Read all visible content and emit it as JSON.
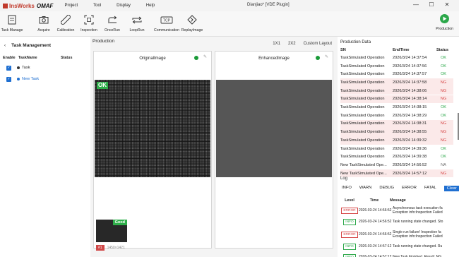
{
  "app": {
    "brand": "InsWorks",
    "product": "OMAF",
    "window_title": "Dianjiao* [VDE Plugin]"
  },
  "menu": [
    "Project",
    "Tool",
    "Display",
    "Help"
  ],
  "toolbar": [
    {
      "label": "Task Manage",
      "icon": "task-manage-icon"
    },
    {
      "label": "Acquire",
      "icon": "camera-icon"
    },
    {
      "label": "Calibration",
      "icon": "ruler-icon"
    },
    {
      "label": "Inspection",
      "icon": "inspection-icon"
    },
    {
      "label": "OnceRun",
      "icon": "once-run-icon"
    },
    {
      "label": "LoopRun",
      "icon": "loop-run-icon"
    },
    {
      "label": "Communication",
      "icon": "tcp-icon"
    },
    {
      "label": "ReplayImage",
      "icon": "replay-icon"
    }
  ],
  "production_button": "Production",
  "task_panel": {
    "title": "Task Management",
    "columns": [
      "Enable",
      "TaskName",
      "Status"
    ],
    "tasks": [
      {
        "name": "Task",
        "enabled": true,
        "dot_color": "#333333"
      },
      {
        "name": "New Task",
        "enabled": true,
        "dot_color": "#1f6fd1"
      }
    ]
  },
  "production": {
    "title": "Production",
    "layouts": [
      "1X1",
      "2X2",
      "Custom Layout"
    ],
    "views": [
      {
        "title": "OriginalImage",
        "badge": "OK"
      },
      {
        "title": "EnhancedImage"
      }
    ],
    "thumbnail": {
      "badge": "Good",
      "index": "#1",
      "size": "1450×1421"
    }
  },
  "production_data": {
    "title": "Production Data",
    "columns": [
      "SN",
      "EndTime",
      "Status"
    ],
    "rows": [
      {
        "sn": "TaskSimulated Operation",
        "time": "2026/3/24 14:37:54",
        "status": "OK"
      },
      {
        "sn": "TaskSimulated Operation",
        "time": "2026/3/24 14:37:56",
        "status": "OK"
      },
      {
        "sn": "TaskSimulated Operation",
        "time": "2026/3/24 14:37:57",
        "status": "OK"
      },
      {
        "sn": "TaskSimulated Operation",
        "time": "2026/3/24 14:37:58",
        "status": "NG"
      },
      {
        "sn": "TaskSimulated Operation",
        "time": "2026/3/24 14:38:06",
        "status": "NG"
      },
      {
        "sn": "TaskSimulated Operation",
        "time": "2026/3/24 14:38:14",
        "status": "NG"
      },
      {
        "sn": "TaskSimulated Operation",
        "time": "2026/3/24 14:38:15",
        "status": "OK"
      },
      {
        "sn": "TaskSimulated Operation",
        "time": "2026/3/24 14:38:29",
        "status": "OK"
      },
      {
        "sn": "TaskSimulated Operation",
        "time": "2026/3/24 14:38:31",
        "status": "NG"
      },
      {
        "sn": "TaskSimulated Operation",
        "time": "2026/3/24 14:38:55",
        "status": "NG"
      },
      {
        "sn": "TaskSimulated Operation",
        "time": "2026/3/24 14:39:32",
        "status": "NG"
      },
      {
        "sn": "TaskSimulated Operation",
        "time": "2026/3/24 14:39:36",
        "status": "OK"
      },
      {
        "sn": "TaskSimulated Operation",
        "time": "2026/3/24 14:39:38",
        "status": "OK"
      },
      {
        "sn": "New TaskSimulated Ope...",
        "time": "2026/3/24 14:56:52",
        "status": "NA"
      },
      {
        "sn": "New TaskSimulated Ope...",
        "time": "2026/3/24 14:57:12",
        "status": "NG"
      }
    ]
  },
  "log": {
    "title": "Log",
    "levels": [
      "INFO",
      "WARN",
      "DEBUG",
      "ERROR",
      "FATAL",
      "Clear"
    ],
    "columns": [
      "Level",
      "Time",
      "Message"
    ],
    "rows": [
      {
        "level": "ERROR",
        "time": "2026-03-24 14:56:52",
        "msg1": "Asynchronous task execution fa",
        "msg2": "Exception info:Inspection Failed"
      },
      {
        "level": "INFO",
        "time": "2026-03-24 14:56:52",
        "msg1": "Task running state changed. Sto",
        "msg2": ""
      },
      {
        "level": "ERROR",
        "time": "2026-03-24 14:56:52",
        "msg1": "Single run failure! Inspection fa",
        "msg2": "Exception info:Inspection Failed"
      },
      {
        "level": "INFO",
        "time": "2026-03-24 14:57:12",
        "msg1": "Task running state changed. Ru",
        "msg2": ""
      },
      {
        "level": "INFO",
        "time": "2026-03-24 14:57:12",
        "msg1": "New Task Finished. Result: NG",
        "msg2": ""
      }
    ]
  },
  "colors": {
    "accent": "#1f6fd1",
    "ok": "#2ca84a",
    "ng": "#d64545",
    "brand": "#c0392b"
  }
}
